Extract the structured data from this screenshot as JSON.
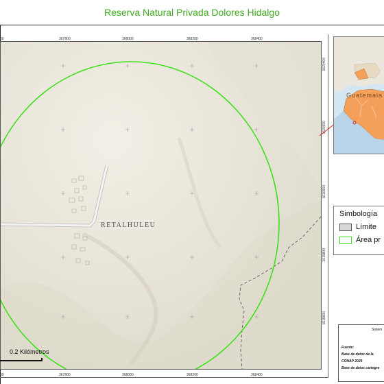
{
  "title": "Reserva Natural Privada Dolores Hidalgo",
  "map": {
    "place_label": "RETALHULEU",
    "x_ticks_top": [
      "367800",
      "368000",
      "368200",
      "368400"
    ],
    "x_ticks_bottom": [
      "367800",
      "368000",
      "368200",
      "368400"
    ],
    "y_ticks_right": [
      "1620400",
      "1620200",
      "1620000",
      "1619800",
      "1619600"
    ],
    "partial_tick_top_left": "00",
    "partial_tick_bottom_left": "00",
    "scale_label": "0.2 Kilómetros",
    "colors": {
      "reserve_outline": "#3ee01a",
      "terrain": "#ebe8de",
      "road": "#c4c4c4",
      "boundary": "#666666"
    }
  },
  "inset": {
    "country_label": "Guatemala",
    "highlight_color": "#f4a05a",
    "locator_color": "#e02020"
  },
  "legend": {
    "title": "Simbología",
    "items": [
      {
        "label": "Límite",
        "color": "#d8d8d8",
        "border": "#555555"
      },
      {
        "label": "Área pr",
        "color": "#ffffff",
        "border": "#3ee01a"
      }
    ]
  },
  "info": {
    "system_label": "Sistem",
    "source_heading": "Fuente:",
    "source_line1": "Base de datos de la",
    "source_line2": "CONAP 2026",
    "source_line3": "Base de datos cartogra"
  }
}
